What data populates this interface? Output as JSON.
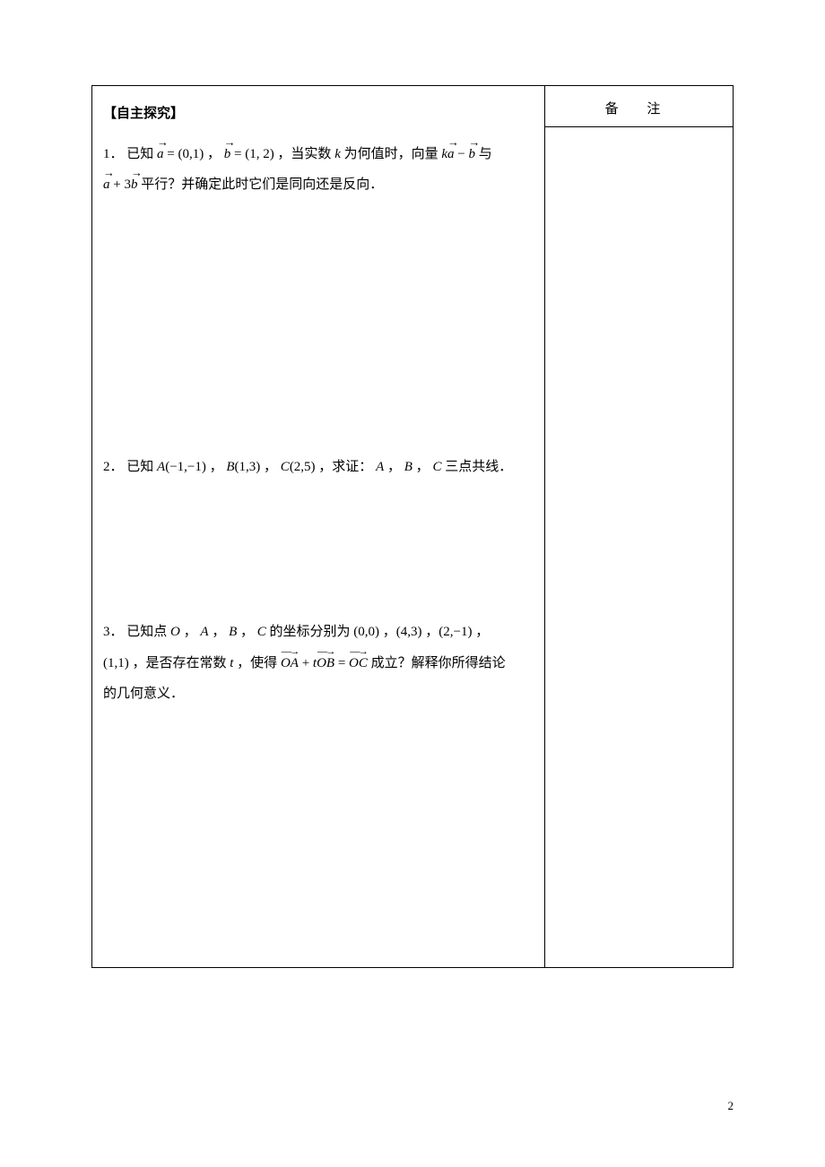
{
  "header": {
    "notes_label": "备  注"
  },
  "section_title": "【自主探究】",
  "problems": {
    "p1": {
      "num": "1．",
      "prefix": "已知 ",
      "a_eq": " = (0,1) ，  ",
      "b_eq": " = (1, 2) ，当实数 ",
      "k": "k",
      "mid": " 为何值时，向量 ",
      "expr_k": "k",
      "minus": " − ",
      "with": " 与",
      "line2_a": "",
      "plus3": " + 3",
      "line2_end": " 平行？并确定此时它们是同向还是反向．"
    },
    "p2": {
      "num": "2．",
      "text_a": "已知 ",
      "A": "A",
      "Acoord": "(−1,−1) ， ",
      "B": "B",
      "Bcoord": "(1,3) ， ",
      "C": "C",
      "Ccoord": "(2,5) ，求证： ",
      "A2": "A",
      "sep1": " ， ",
      "B2": "B",
      "sep2": " ， ",
      "C2": "C",
      "tail": " 三点共线．"
    },
    "p3": {
      "num": "3．",
      "pre": "已知点 ",
      "O": "O",
      "c1": " ， ",
      "A": "A",
      "c2": " ， ",
      "B": "B",
      "c3": " ， ",
      "C": "C",
      "coords": " 的坐标分别为 (0,0) ，(4,3) ，(2,−1) ，",
      "line2_coord": "(1,1) ，是否存在常数 ",
      "t": "t",
      "mid2": " ，使得 ",
      "OA": "OA",
      "plus": " + ",
      "t2": "t",
      "OB": "OB",
      "eq": " = ",
      "OC": "OC",
      "tail2": " 成立？解释你所得结论",
      "line3": "的几何意义．"
    }
  },
  "page_number": "2"
}
